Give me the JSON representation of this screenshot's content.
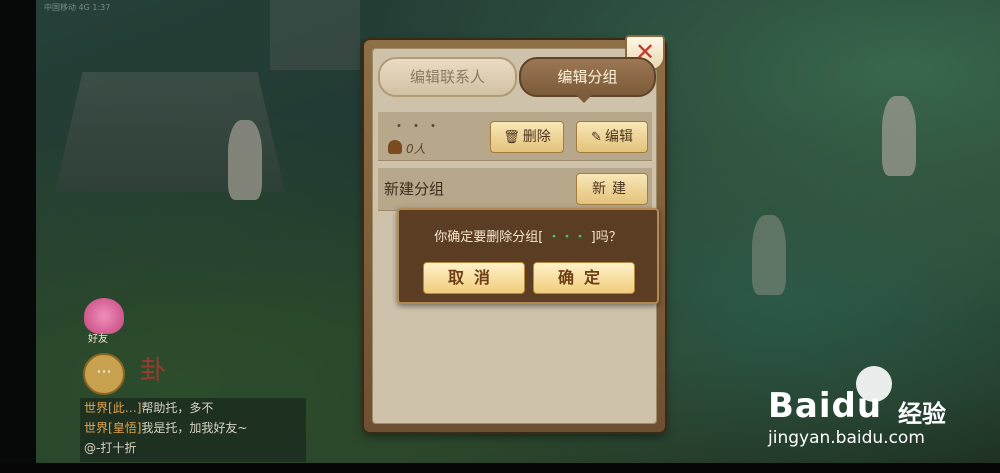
{
  "status_bar": {
    "text": "中国移动 4G 1:37"
  },
  "panel": {
    "close_glyph": "✕",
    "tabs": [
      {
        "label": "编辑联系人",
        "active": false
      },
      {
        "label": "编辑分组",
        "active": true
      }
    ],
    "group_row": {
      "name": "・・・",
      "member_count": "0人",
      "delete_label": "删除",
      "edit_label": "编辑"
    },
    "new_group_row": {
      "label": "新建分组",
      "button_label": "新建"
    }
  },
  "dialog": {
    "message_prefix": "你确定要删除分组[",
    "group_name": " ・・・ ",
    "message_suffix": "]吗？",
    "cancel_label": "取消",
    "confirm_label": "确定"
  },
  "hud": {
    "friend_label": "好友",
    "chat_icon": "···",
    "chat_lines": [
      {
        "channel": "世界",
        "sender": "[此…]",
        "text": "帮助托，多不"
      },
      {
        "channel": "世界",
        "sender": "[皇悟]",
        "text": "我是托，加我好友~"
      },
      {
        "channel": "",
        "sender": "",
        "text": "@-打十折"
      }
    ]
  },
  "watermark": {
    "logo": "Baidu",
    "suffix": "经验",
    "url": "jingyan.baidu.com"
  },
  "colors": {
    "panel_frame": "#8f6f45",
    "panel_surface": "#cfc2ab",
    "close_x": "#c63a2c",
    "button_gold": "#f1cd7c",
    "dialog_bg": "#5a3d23",
    "group_name_green": "#3cc77a"
  }
}
